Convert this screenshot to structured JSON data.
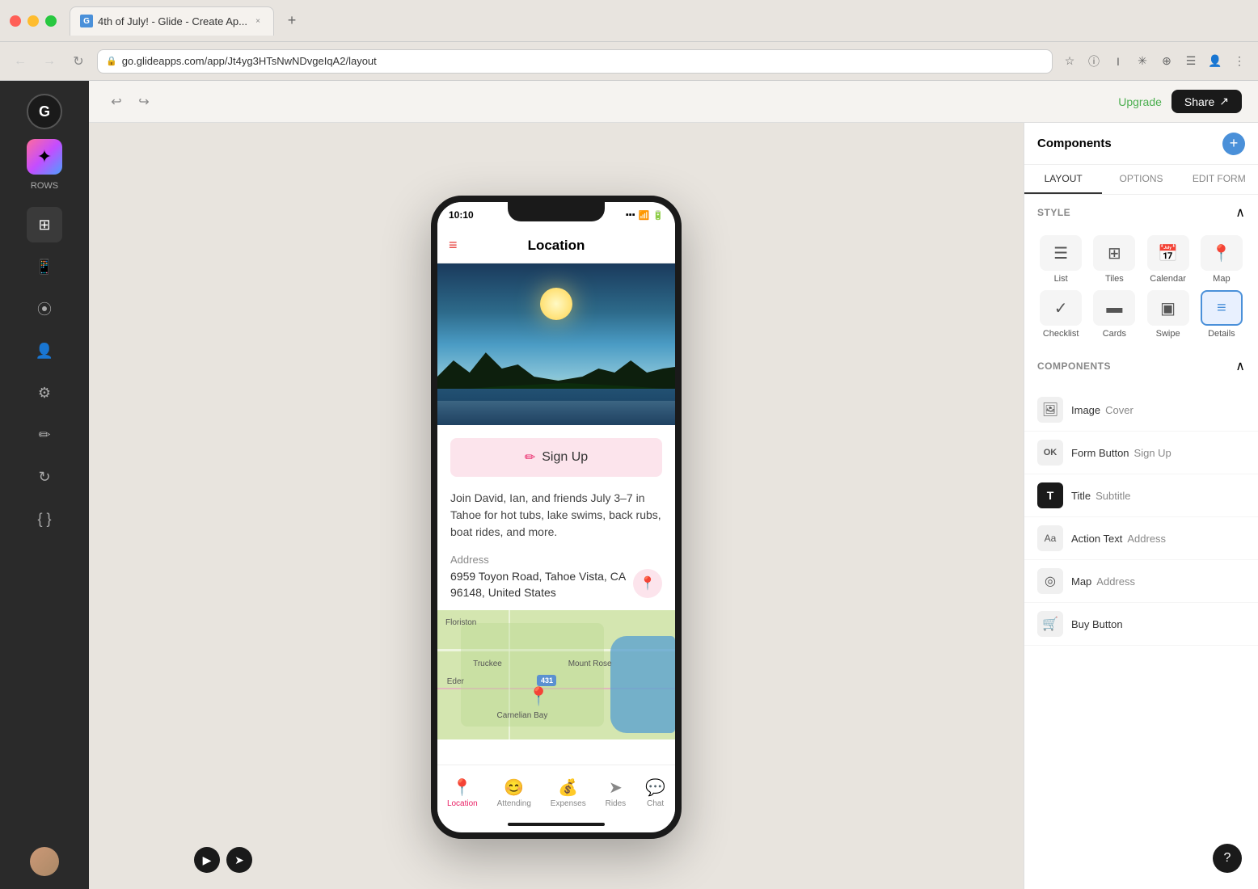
{
  "browser": {
    "tab_title": "4th of July! - Glide - Create Ap...",
    "tab_close": "×",
    "new_tab": "+",
    "address": "go.glideapps.com/app/Jt4yg3HTsNwNDvgeIqA2/layout",
    "nav_back": "←",
    "nav_forward": "→",
    "nav_refresh": "↻"
  },
  "toolbar": {
    "undo_label": "↩",
    "redo_label": "↪",
    "upgrade_label": "Upgrade",
    "share_label": "Share",
    "share_icon": "↗"
  },
  "sidebar": {
    "app_initial": "G",
    "rows_label": "ROWS",
    "nav_items": [
      {
        "name": "layout",
        "icon": "⊞",
        "active": true
      },
      {
        "name": "mobile",
        "icon": "📱",
        "active": false
      },
      {
        "name": "data",
        "icon": "🗄",
        "active": false
      },
      {
        "name": "user",
        "icon": "👤",
        "active": false
      },
      {
        "name": "settings",
        "icon": "⚙",
        "active": false
      },
      {
        "name": "edit",
        "icon": "✏",
        "active": false
      },
      {
        "name": "sync",
        "icon": "↻",
        "active": false
      },
      {
        "name": "code",
        "icon": "{ }",
        "active": false
      }
    ]
  },
  "phone": {
    "status_time": "10:10",
    "title": "Location",
    "hamburger": "≡",
    "signup_label": "Sign Up",
    "signup_icon": "✏",
    "description": "Join David, Ian, and friends July 3–7 in Tahoe for hot tubs, lake swims, back rubs, boat rides, and more.",
    "address_label": "Address",
    "address_line1": "6959 Toyon Road, Tahoe Vista, CA",
    "address_line2": "96148, United States",
    "location_pin": "📍",
    "tabs": [
      {
        "name": "Location",
        "icon": "📍",
        "active": true
      },
      {
        "name": "Attending",
        "icon": "😊",
        "active": false
      },
      {
        "name": "Expenses",
        "icon": "💰",
        "active": false
      },
      {
        "name": "Rides",
        "icon": "➤",
        "active": false
      },
      {
        "name": "Chat",
        "icon": "💬",
        "active": false
      }
    ]
  },
  "components_panel": {
    "title": "Components",
    "add_icon": "+",
    "tabs": [
      {
        "label": "LAYOUT",
        "active": true
      },
      {
        "label": "OPTIONS",
        "active": false
      },
      {
        "label": "EDIT FORM",
        "active": false
      }
    ],
    "style_section_title": "STYLE",
    "style_collapse_icon": "∧",
    "styles": [
      {
        "label": "List",
        "icon": "☰",
        "active": false
      },
      {
        "label": "Tiles",
        "icon": "⊞",
        "active": false
      },
      {
        "label": "Calendar",
        "icon": "📅",
        "active": false
      },
      {
        "label": "Map",
        "icon": "📍",
        "active": false
      },
      {
        "label": "Checklist",
        "icon": "✓",
        "active": false
      },
      {
        "label": "Cards",
        "icon": "▬",
        "active": false
      },
      {
        "label": "Swipe",
        "icon": "▣",
        "active": false
      },
      {
        "label": "Details",
        "icon": "≡",
        "active": true
      }
    ],
    "components_section_title": "COMPONENTS",
    "components_collapse_icon": "∧",
    "components": [
      {
        "primary": "Image",
        "secondary": "Cover",
        "icon": "🖼"
      },
      {
        "primary": "Form Button",
        "secondary": "Sign Up",
        "icon": "OK"
      },
      {
        "primary": "Title",
        "secondary": "Subtitle",
        "icon": "T"
      },
      {
        "primary": "Action Text",
        "secondary": "Address",
        "icon": "Aa"
      },
      {
        "primary": "Map",
        "secondary": "Address",
        "icon": "◎"
      },
      {
        "primary": "Buy Button",
        "secondary": "",
        "icon": "🛒"
      }
    ]
  },
  "bottom": {
    "play_icon": "▶",
    "cursor_icon": "➤",
    "help_icon": "?"
  }
}
